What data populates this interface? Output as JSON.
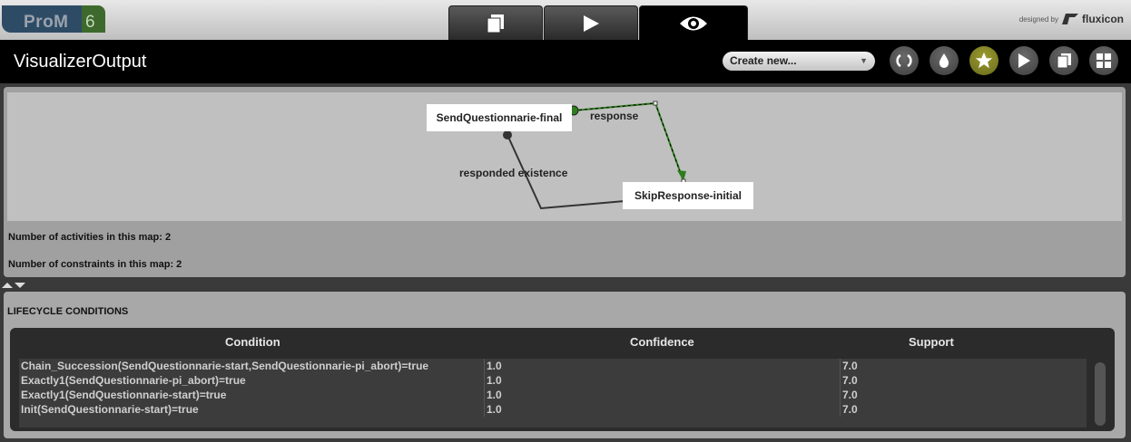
{
  "app": {
    "logo_text": "ProM",
    "logo_version": "6",
    "designed_by": "designed by",
    "brand": "fluxicon"
  },
  "tabs": [
    {
      "name": "workspace",
      "icon": "documents-icon"
    },
    {
      "name": "actions",
      "icon": "play-icon"
    },
    {
      "name": "views",
      "icon": "eye-icon"
    }
  ],
  "header": {
    "title": "VisualizerOutput",
    "create_new": "Create new..."
  },
  "toolbar_icons": [
    "refresh-icon",
    "drop-icon",
    "star-icon",
    "play-icon",
    "copy-icon",
    "grid-icon"
  ],
  "graph": {
    "nodes": [
      "SendQuestionnarie-final",
      "SkipResponse-initial"
    ],
    "edges": [
      {
        "label": "response",
        "from": "SendQuestionnarie-final",
        "to": "SkipResponse-initial"
      },
      {
        "label": "responded existence",
        "from": "SendQuestionnarie-final",
        "to": "SkipResponse-initial"
      }
    ]
  },
  "stats": {
    "activities": "Number of activities in this map: 2",
    "constraints": "Number of constraints in this map: 2"
  },
  "lifecycle": {
    "title": "LIFECYCLE CONDITIONS",
    "headers": [
      "Condition",
      "Confidence",
      "Support"
    ],
    "rows": [
      [
        "Chain_Succession(SendQuestionnarie-start,SendQuestionnarie-pi_abort)=true",
        "1.0",
        "7.0"
      ],
      [
        "Exactly1(SendQuestionnarie-pi_abort)=true",
        "1.0",
        "7.0"
      ],
      [
        "Exactly1(SendQuestionnarie-start)=true",
        "1.0",
        "7.0"
      ],
      [
        "Init(SendQuestionnarie-start)=true",
        "1.0",
        "7.0"
      ]
    ]
  },
  "colors": {
    "accent_star": "#7d7d22",
    "response_edge": "#2e7d1e",
    "background": "#3a3a3a"
  }
}
